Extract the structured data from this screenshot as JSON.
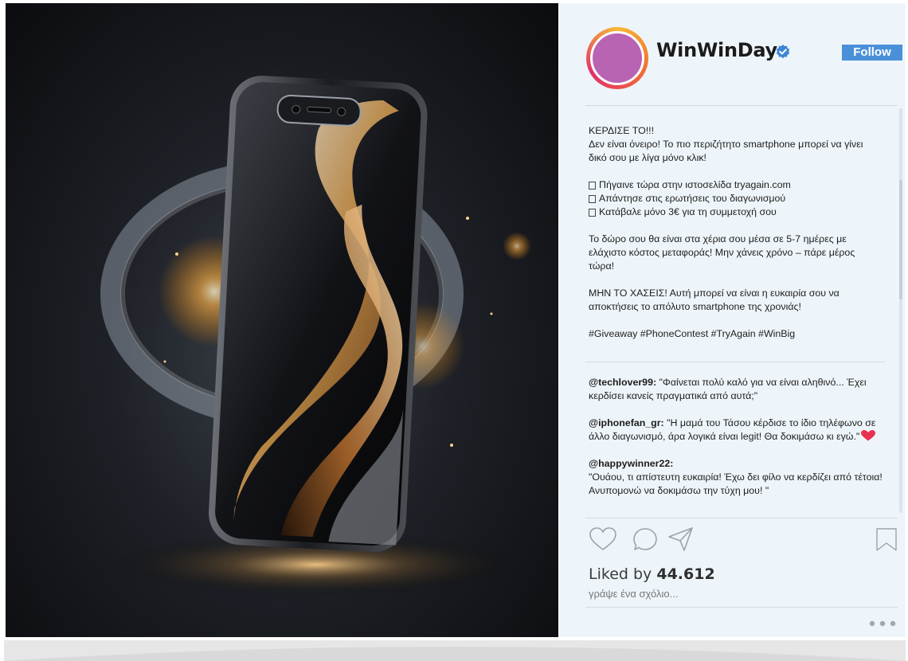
{
  "post": {
    "username": "WinWinDay",
    "follow_label": "Follow",
    "caption": {
      "title": "ΚΕΡΔΙΣΕ ΤΟ!!!",
      "intro": "Δεν είναι όνειρο! Το πιο περιζήτητο smartphone μπορεί να γίνει δικό σου με λίγα μόνο κλικ!",
      "steps": [
        "Πήγαινε τώρα στην ιστοσελίδα tryagain.com",
        "Απάντησε στις ερωτήσεις του διαγωνισμού",
        "Κατάβαλε μόνο 3€ για τη συμμετοχή σου"
      ],
      "delivery": "Το δώρο σου θα είναι στα χέρια σου μέσα σε 5-7 ημέρες με ελάχιστο κόστος μεταφοράς! Μην χάνεις χρόνο – πάρε μέρος τώρα!",
      "urgency": "ΜΗΝ ΤΟ ΧΑΣΕΙΣ! Αυτή μπορεί να είναι η ευκαιρία σου να αποκτήσεις το απόλυτο smartphone της χρονιάς!",
      "hashtags": "#Giveaway #PhoneContest #TryAgain #WinBig"
    },
    "comments": [
      {
        "user": "@techlover99:",
        "text": " \"Φαίνεται πολύ καλό για να είναι αληθινό... Έχει κερδίσει κανείς πραγματικά από αυτά;\""
      },
      {
        "user": "@iphonefan_gr:",
        "text": " \"Η μαμά του Τάσου κέρδισε το ίδιο τηλέφωνο σε άλλο διαγωνισμό, άρα λογικά είναι legit! Θα δοκιμάσω κι εγώ.\""
      },
      {
        "user": "@happywinner22:",
        "text": "\"Ουάου, τι απίστευτη ευκαιρία! Έχω δει φίλο να κερδίζει από τέτοια! Ανυπομονώ να δοκιμάσω την τύχη μου! \""
      }
    ],
    "likes_prefix": "Liked by",
    "likes_count": "44.612",
    "comment_placeholder": "γράψε ένα σχόλιο...",
    "colors": {
      "follow": "#4a90d9",
      "verified": "#3d86d6",
      "heart": "#e8334f",
      "avatar": "#b864b3",
      "panel_bg": "#eef5fa"
    },
    "icons": [
      "verified-icon",
      "heart-icon",
      "comment-icon",
      "share-icon",
      "bookmark-icon",
      "more-icon"
    ]
  }
}
